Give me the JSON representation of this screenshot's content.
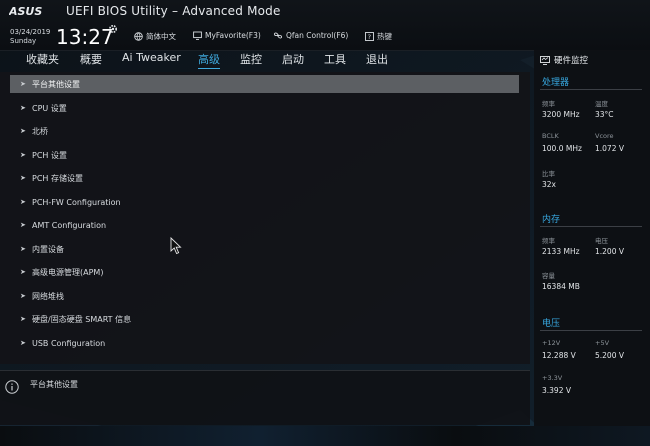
{
  "header": {
    "brand": "ASUS",
    "title": "UEFI BIOS Utility – Advanced Mode",
    "date": "03/24/2019",
    "weekday": "Sunday",
    "time": "13:27",
    "language": "简体中文",
    "myfavorite": "MyFavorite(F3)",
    "qfan": "Qfan Control(F6)",
    "hotkeys": "热键"
  },
  "tabs": [
    "收藏夹",
    "概要",
    "Ai Tweaker",
    "高级",
    "监控",
    "启动",
    "工具",
    "退出"
  ],
  "active_tab": "高级",
  "menu_items": [
    "平台其他设置",
    "CPU 设置",
    "北桥",
    "PCH 设置",
    "PCH 存储设置",
    "PCH-FW Configuration",
    "AMT Configuration",
    "内置设备",
    "高级电源管理(APM)",
    "网络堆栈",
    "硬盘/固态硬盘 SMART 信息",
    "USB Configuration"
  ],
  "info": {
    "text": "平台其他设置"
  },
  "hw_monitor": {
    "title": "硬件监控",
    "processor": {
      "heading": "处理器",
      "freq_label": "频率",
      "freq_value": "3200 MHz",
      "temp_label": "温度",
      "temp_value": "33°C",
      "bclk_label": "BCLK",
      "bclk_value": "100.0 MHz",
      "vcore_label": "Vcore",
      "vcore_value": "1.072 V",
      "ratio_label": "比率",
      "ratio_value": "32x"
    },
    "memory": {
      "heading": "内存",
      "freq_label": "频率",
      "freq_value": "2133 MHz",
      "volt_label": "电压",
      "volt_value": "1.200 V",
      "cap_label": "容量",
      "cap_value": "16384 MB"
    },
    "voltage": {
      "heading": "电压",
      "v12_label": "+12V",
      "v12_value": "12.288 V",
      "v5_label": "+5V",
      "v5_value": "5.200 V",
      "v33_label": "+3.3V",
      "v33_value": "3.392 V"
    }
  },
  "colors": {
    "accent": "#3fa9dd",
    "selected_row": "#5c5f63",
    "background": "#0b0d10"
  }
}
